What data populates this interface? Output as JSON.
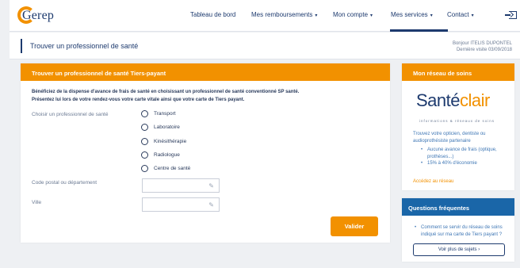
{
  "brand": {
    "name": "Gerep"
  },
  "nav": {
    "items": [
      {
        "label": "Tableau de bord",
        "has_dropdown": false
      },
      {
        "label": "Mes remboursements",
        "has_dropdown": true
      },
      {
        "label": "Mon compte",
        "has_dropdown": true
      },
      {
        "label": "Mes services",
        "has_dropdown": true,
        "active": true
      },
      {
        "label": "Contact",
        "has_dropdown": true
      }
    ],
    "dropdown_glyph": "▾",
    "logout_icon": "logout-icon"
  },
  "page": {
    "title": "Trouver un professionnel de santé",
    "greeting": "Bonjour ITELIS DUPONTEL",
    "last_visit": "Dernière visite 03/09/2018"
  },
  "form_card": {
    "title": "Trouver un professionnel de santé Tiers-payant",
    "intro_line1": "Bénéficiez de la dispense d'avance de frais de santé en choisissant un professionnel de santé conventionné SP santé.",
    "intro_line2": "Présentez lui lors de votre rendez-vous votre carte vitale ainsi que votre carte de Tiers payant.",
    "choose_label": "Choisir un professionnel de santé",
    "options": [
      "Transport",
      "Laboratoire",
      "Kinésithérapie",
      "Radiologue",
      "Centre de santé"
    ],
    "postal_label": "Code postal ou département",
    "postal_value": "",
    "city_label": "Ville",
    "city_value": "",
    "submit_label": "Valider"
  },
  "network_card": {
    "title": "Mon réseau de soins",
    "logo_part1": "Santé",
    "logo_part2": "clair",
    "logo_tagline": "informations & réseaux de soins",
    "text": "Trouvez votre opticien, dentiste ou audioprothésiste partenaire",
    "bullets": [
      "Aucune avance de frais (optique, prothèses...)",
      "15% à 40% d'économie"
    ],
    "link": "Accédez au réseau"
  },
  "faq_card": {
    "title": "Questions fréquentes",
    "item": "Comment se servir du réseau de soins indiqué sur ma carte de Tiers payant ?",
    "more_label": "Voir plus de sujets",
    "more_glyph": "›"
  },
  "colors": {
    "accent": "#f29100",
    "navy": "#1d3a6e",
    "faq_blue": "#1a66a8",
    "link_blue": "#3f77b5"
  }
}
